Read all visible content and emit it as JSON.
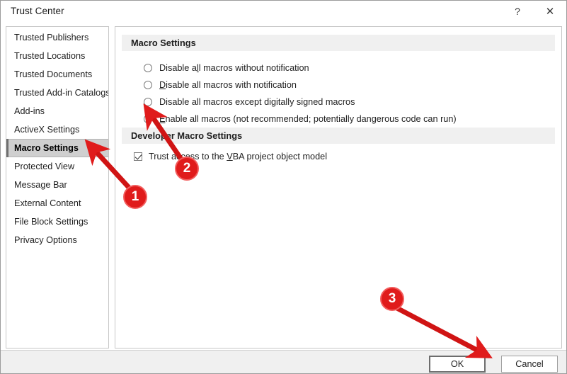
{
  "window": {
    "title": "Trust Center",
    "help_label": "?",
    "close_label": "✕"
  },
  "sidebar": {
    "selected": "Macro Settings",
    "items": [
      {
        "label": "Trusted Publishers"
      },
      {
        "label": "Trusted Locations"
      },
      {
        "label": "Trusted Documents"
      },
      {
        "label": "Trusted Add-in Catalogs"
      },
      {
        "label": "Add-ins"
      },
      {
        "label": "ActiveX Settings"
      },
      {
        "label": "Macro Settings"
      },
      {
        "label": "Protected View"
      },
      {
        "label": "Message Bar"
      },
      {
        "label": "External Content"
      },
      {
        "label": "File Block Settings"
      },
      {
        "label": "Privacy Options"
      }
    ]
  },
  "main": {
    "macro_section_title": "Macro Settings",
    "developer_section_title": "Developer Macro Settings",
    "macro_options": [
      {
        "pre": "Disable a",
        "key": "l",
        "post": "l macros without notification",
        "selected": false
      },
      {
        "pre": "",
        "key": "D",
        "post": "isable all macros with notification",
        "selected": false
      },
      {
        "pre": "Disable all macros except di",
        "key": "g",
        "post": "itally signed macros",
        "selected": false
      },
      {
        "pre": "",
        "key": "E",
        "post": "nable all macros (not recommended; potentially dangerous code can run)",
        "selected": true
      }
    ],
    "developer_checkbox": {
      "pre": "Trust access to the ",
      "key": "V",
      "post": "BA project object model",
      "checked": true
    }
  },
  "footer": {
    "ok_label": "OK",
    "cancel_label": "Cancel"
  },
  "annotations": {
    "badges": [
      {
        "number": "1"
      },
      {
        "number": "2"
      },
      {
        "number": "3"
      }
    ],
    "color": "#e01b1b"
  }
}
